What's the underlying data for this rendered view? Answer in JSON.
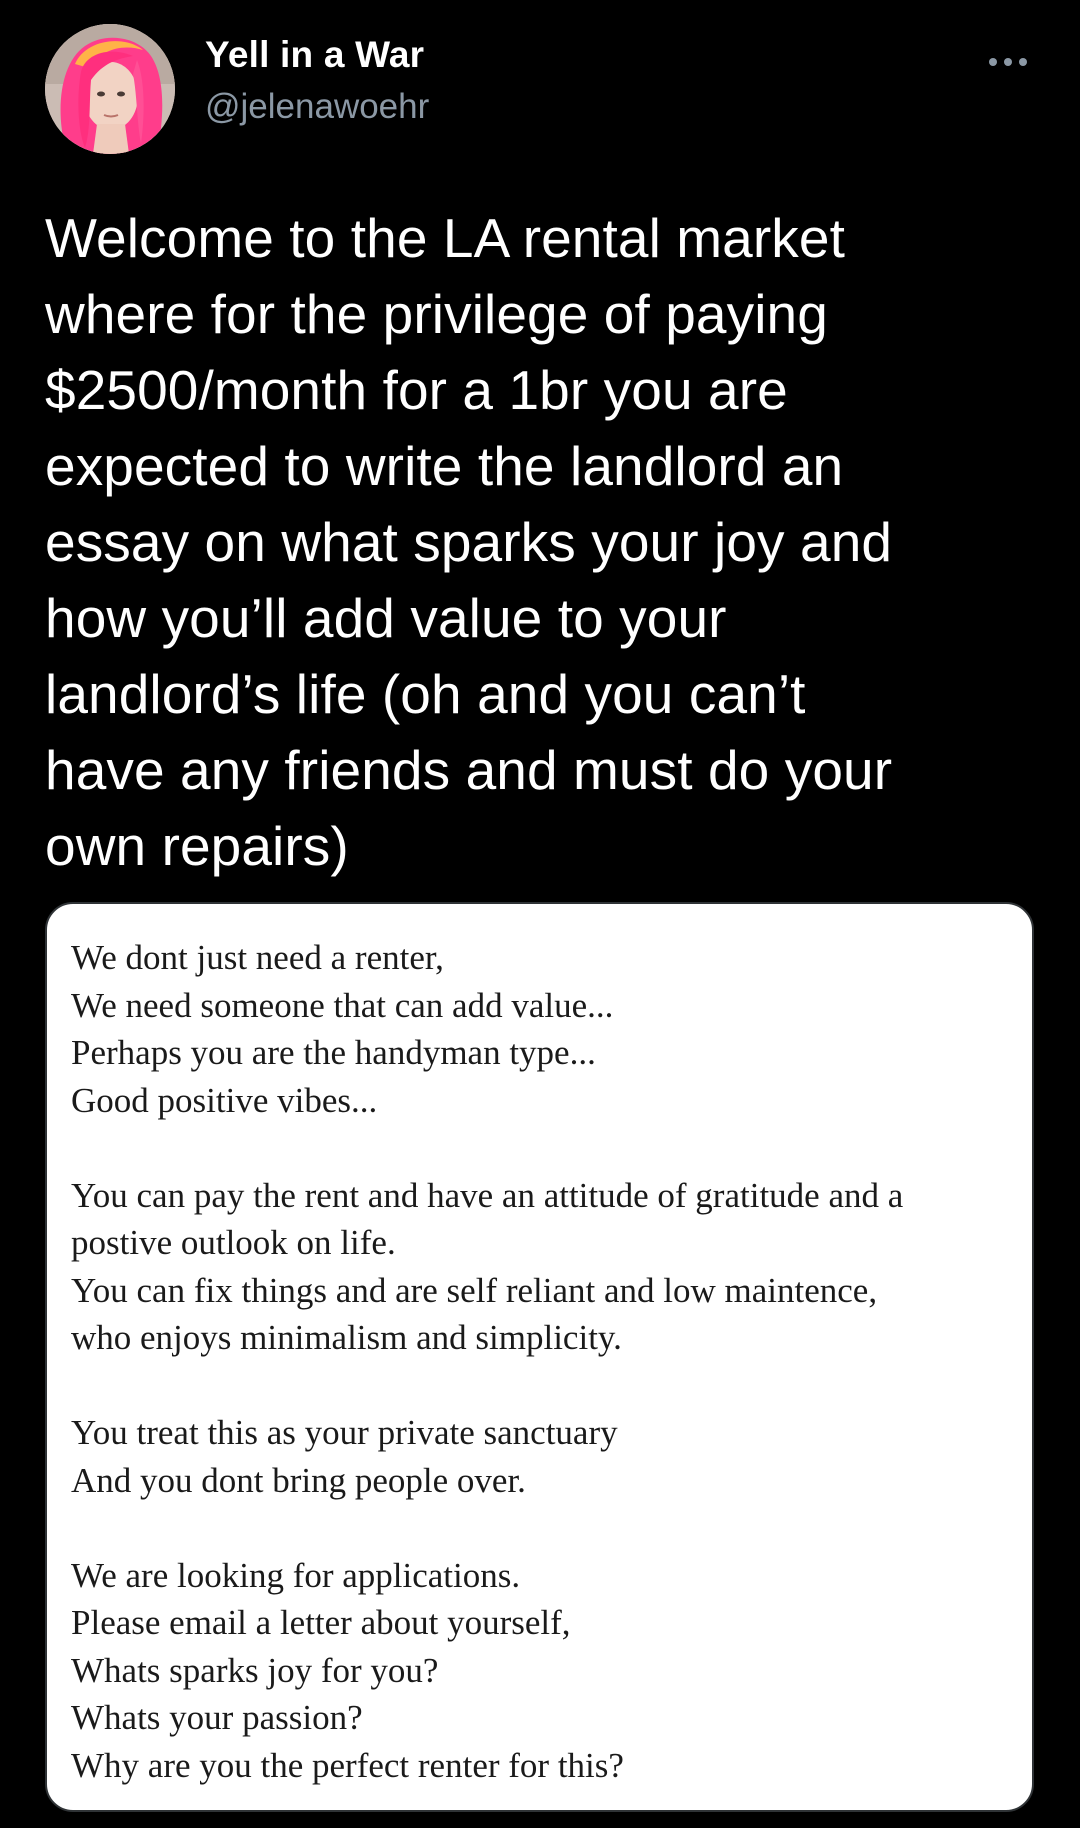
{
  "tweet": {
    "author": {
      "display_name": "Yell in a War",
      "handle": "@jelenawoehr",
      "avatar_icon": "profile-photo"
    },
    "more_icon": "more-horizontal-icon",
    "text": "Welcome to the LA rental market\nwhere for the privilege of paying\n$2500/month for a 1br you are\nexpected to write the landlord an\nessay on what sparks your joy and\nhow you’ll add value to your\nlandlord’s life (oh and you can’t\nhave any friends and must do your\nown repairs)",
    "media": {
      "paragraphs": [
        [
          "We dont just need a renter,",
          "We need someone that can add value...",
          "Perhaps you are the handyman type...",
          "Good positive vibes..."
        ],
        [
          "You can pay the rent and have an attitude of gratitude and a",
          "postive outlook on life.",
          "You can fix things and are self reliant and low maintence,",
          "who enjoys minimalism and simplicity."
        ],
        [
          "You treat this as your private sanctuary",
          "And you dont bring people over."
        ],
        [
          "We are looking for applications.",
          "Please email a letter about yourself,",
          "Whats sparks joy for you?",
          "Whats your passion?",
          "Why are you the perfect renter for this?"
        ]
      ]
    }
  },
  "colors": {
    "background": "#000000",
    "primary_text": "#ffffff",
    "secondary_text": "#8b98a5",
    "card_background": "#ffffff",
    "letter_text": "#1a1a1a",
    "avatar_hair": "#ff3d8b"
  }
}
